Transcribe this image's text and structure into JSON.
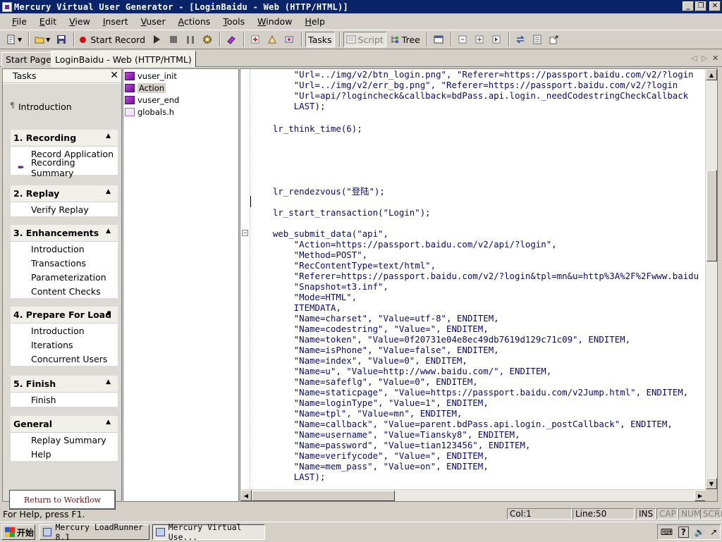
{
  "window": {
    "title": "Mercury Virtual User Generator - [LoginBaidu - Web (HTTP/HTML)]",
    "buttons": {
      "minimize": "_",
      "restore": "❐",
      "close": "✕"
    }
  },
  "menu": {
    "items": [
      {
        "label": "File",
        "accel": "F",
        "rest": "ile"
      },
      {
        "label": "Edit",
        "accel": "E",
        "rest": "dit"
      },
      {
        "label": "View",
        "accel": "V",
        "rest": "iew"
      },
      {
        "label": "Insert",
        "accel": "I",
        "rest": "nsert"
      },
      {
        "label": "Vuser",
        "accel": "V",
        "rest": "user"
      },
      {
        "label": "Actions",
        "accel": "A",
        "rest": "ctions"
      },
      {
        "label": "Tools",
        "accel": "T",
        "rest": "ools"
      },
      {
        "label": "Window",
        "accel": "W",
        "rest": "indow"
      },
      {
        "label": "Help",
        "accel": "H",
        "rest": "elp"
      }
    ]
  },
  "toolbar": {
    "start_record": "Start Record",
    "tasks": "Tasks",
    "script": "Script",
    "tree": "Tree"
  },
  "tabs": {
    "start_page": "Start Page",
    "active": "LoginBaidu - Web (HTTP/HTML)",
    "nav_prev": "◁",
    "nav_next": "▷",
    "close": "✕"
  },
  "tasks_pane": {
    "title": "Tasks",
    "close": "✕",
    "introduction": "Introduction",
    "groups": [
      {
        "title": "1. Recording",
        "items": [
          "Record Application",
          "Recording Summary"
        ],
        "current": 1
      },
      {
        "title": "2. Replay",
        "items": [
          "Verify Replay"
        ],
        "current": -1
      },
      {
        "title": "3. Enhancements",
        "items": [
          "Introduction",
          "Transactions",
          "Parameterization",
          "Content Checks"
        ],
        "current": -1
      },
      {
        "title": "4. Prepare For Load",
        "items": [
          "Introduction",
          "Iterations",
          "Concurrent Users"
        ],
        "current": -1
      },
      {
        "title": "5. Finish",
        "items": [
          "Finish"
        ],
        "current": -1
      },
      {
        "title": "General",
        "items": [
          "Replay Summary",
          "Help"
        ],
        "current": -1
      }
    ],
    "return_button": "Return to Workflow"
  },
  "tree": {
    "items": [
      "vuser_init",
      "Action",
      "vuser_end",
      "globals.h"
    ],
    "selected": 1
  },
  "code": {
    "lines": [
      "        \"Url=../img/v2/btn_login.png\", \"Referer=https://passport.baidu.com/v2/?login",
      "        \"Url=../img/v2/err_bg.png\", \"Referer=https://passport.baidu.com/v2/?login",
      "        \"Url=api/?logincheck&callback=bdPass.api.login._needCodestringCheckCallback",
      "        LAST);",
      "",
      "    lr_think_time(6);",
      "",
      "",
      "",
      "",
      "",
      "",
      "    lr_rendezvous(\"登陆\");",
      "",
      "    lr_start_transaction(\"Login\");",
      "",
      "    web_submit_data(\"api\",",
      "        \"Action=https://passport.baidu.com/v2/api/?login\",",
      "        \"Method=POST\",",
      "        \"RecContentType=text/html\",",
      "        \"Referer=https://passport.baidu.com/v2/?login&tpl=mn&u=http%3A%2F%2Fwww.baidu",
      "        \"Snapshot=t3.inf\",",
      "        \"Mode=HTML\",",
      "        ITEMDATA,",
      "        \"Name=charset\", \"Value=utf-8\", ENDITEM,",
      "        \"Name=codestring\", \"Value=\", ENDITEM,",
      "        \"Name=token\", \"Value=0f20731e04e8ec49db7619d129c71c09\", ENDITEM,",
      "        \"Name=isPhone\", \"Value=false\", ENDITEM,",
      "        \"Name=index\", \"Value=0\", ENDITEM,",
      "        \"Name=u\", \"Value=http://www.baidu.com/\", ENDITEM,",
      "        \"Name=safeflg\", \"Value=0\", ENDITEM,",
      "        \"Name=staticpage\", \"Value=https://passport.baidu.com/v2Jump.html\", ENDITEM,",
      "        \"Name=loginType\", \"Value=1\", ENDITEM,",
      "        \"Name=tpl\", \"Value=mn\", ENDITEM,",
      "        \"Name=callback\", \"Value=parent.bdPass.api.login._postCallback\", ENDITEM,",
      "        \"Name=username\", \"Value=Tiansky8\", ENDITEM,",
      "        \"Name=password\", \"Value=tian123456\", ENDITEM,",
      "        \"Name=verifycode\", \"Value=\", ENDITEM,",
      "        \"Name=mem_pass\", \"Value=on\", ENDITEM,",
      "        LAST);"
    ],
    "fold_marker": "−"
  },
  "status": {
    "help": "For Help, press F1.",
    "col": "Col:1",
    "line": "Line:50",
    "ins": "INS",
    "cap": "CAP",
    "num": "NUM",
    "scrl": "SCRL"
  },
  "taskbar": {
    "start": "开始",
    "buttons": [
      "Mercury LoadRunner 8.1",
      "Mercury Virtual Use..."
    ],
    "active": 1,
    "tray": [
      "⌨",
      "?",
      "🔊",
      "↗"
    ]
  }
}
